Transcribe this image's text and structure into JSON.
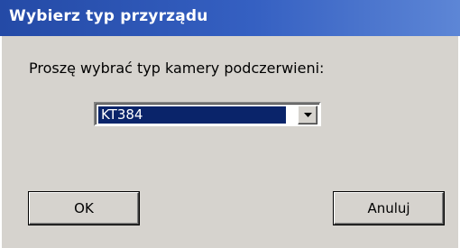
{
  "window": {
    "title": "Wybierz typ przyrządu"
  },
  "dialog": {
    "prompt": "Proszę wybrać typ kamery podczerwieni:",
    "camera_select": {
      "selected_value": "KT384"
    },
    "ok_label": "OK",
    "cancel_label": "Anuluj"
  },
  "colors": {
    "titlebar_start": "#244aa6",
    "titlebar_end": "#5d86d6",
    "dialog_background": "#d6d3ce",
    "selection_background": "#0a246a"
  },
  "icons": {
    "dropdown": "chevron-down-icon"
  }
}
